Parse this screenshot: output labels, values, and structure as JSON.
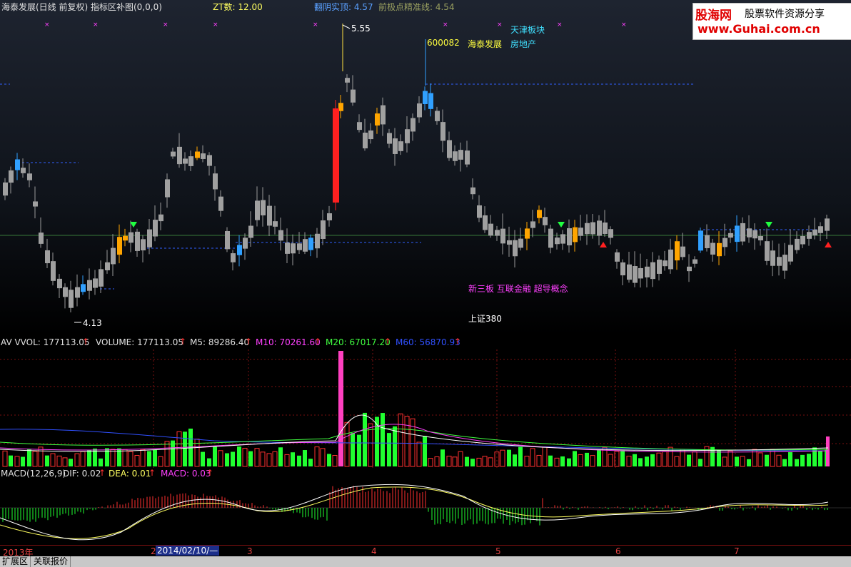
{
  "header": {
    "title": "海泰发展(日线 前复权) 指标区补图(0,0,0)",
    "zt": "ZT数: 12.00",
    "fy": "翻阴实顶: 4.57",
    "qj": "前极点精准线: 4.54"
  },
  "stock": {
    "code": "600082",
    "name": "海泰发展",
    "sector1": "天津板块",
    "sector2": "房地产",
    "concepts": "新三板 互联金融 超导概念",
    "index": "上证380",
    "high_label": "5.55",
    "low_label": "4.13"
  },
  "volume": {
    "av": "AV VVOL: 177113.05",
    "vol": "VOLUME: 177113.05",
    "m5": "M5: 89286.40",
    "m10": "M10: 70261.60",
    "m20": "M20: 67017.20",
    "m60": "M60: 56870.93"
  },
  "macd": {
    "name": "MACD(12,26,9)",
    "dif": "DIF: 0.02",
    "dea": "DEA: 0.01",
    "macd": "MACD: 0.03"
  },
  "dates": {
    "year": "2013年",
    "m2": "2",
    "cursor": "2014/02/10/—",
    "m3": "3",
    "m4": "4",
    "m5": "5",
    "m6": "6",
    "m7": "7"
  },
  "tabs": [
    "扩展区",
    "关联报价"
  ],
  "logo": {
    "brand": "股海网",
    "slogan": "股票软件资源分享",
    "url": "www.Guhai.com.cn"
  },
  "colors": {
    "up": "#ff3030",
    "down": "#00ff30",
    "gray": "#a0a0a0",
    "orange": "#ffa500",
    "blue": "#30a0ff",
    "magenta": "#ff40ff"
  }
}
